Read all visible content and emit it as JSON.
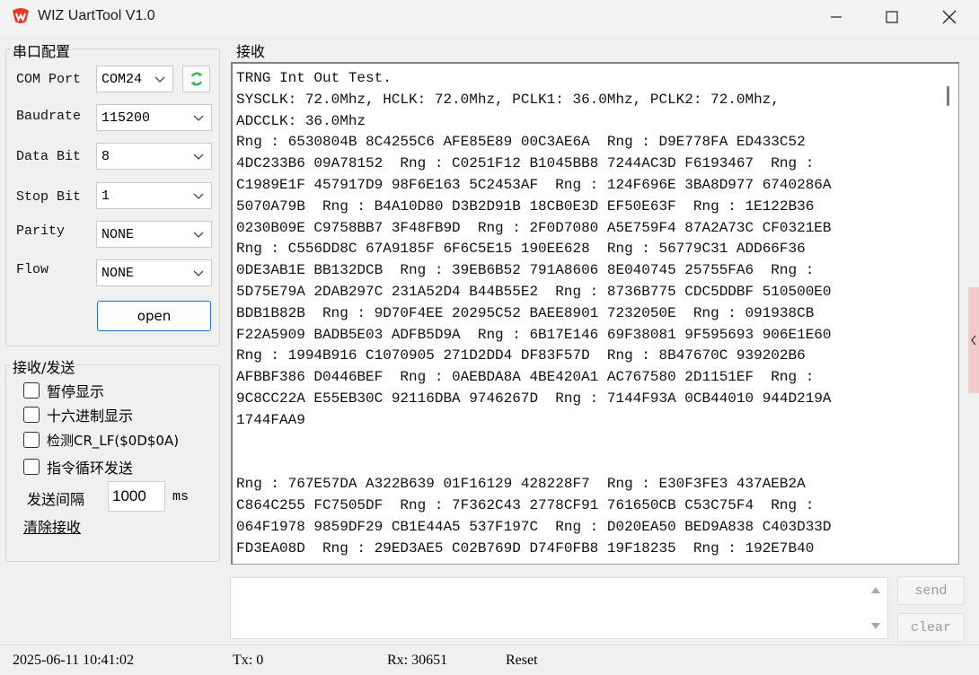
{
  "window": {
    "title": "WIZ UartTool V1.0"
  },
  "serial": {
    "group_title": "串口配置",
    "com_port": {
      "label": "COM Port",
      "value": "COM24"
    },
    "baudrate": {
      "label": "Baudrate",
      "value": "115200"
    },
    "data_bit": {
      "label": "Data Bit",
      "value": "8"
    },
    "stop_bit": {
      "label": "Stop Bit",
      "value": "1"
    },
    "parity": {
      "label": "Parity",
      "value": "NONE"
    },
    "flow": {
      "label": "Flow",
      "value": "NONE"
    },
    "open_label": "open",
    "refresh_icon": "refresh-icon",
    "refresh_color": "#2fb84a"
  },
  "rxtx": {
    "group_title": "接收/发送",
    "pause_display": "暂停显示",
    "hex_display": "十六进制显示",
    "detect_crlf": "检测CR_LF($0D$0A)",
    "loop_send": "指令循环发送",
    "interval_label": "发送间隔",
    "interval_value": "1000",
    "interval_unit": "ms",
    "clear_label": "清除接收"
  },
  "receive": {
    "title": "接收",
    "lines": [
      "TRNG Int Out Test.",
      "SYSCLK: 72.0Mhz, HCLK: 72.0Mhz, PCLK1: 36.0Mhz, PCLK2: 72.0Mhz,",
      "ADCCLK: 36.0Mhz",
      "Rng : 6530804B 8C4255C6 AFE85E89 00C3AE6A  Rng : D9E778FA ED433C52",
      "4DC233B6 09A78152  Rng : C0251F12 B1045BB8 7244AC3D F6193467  Rng :",
      "C1989E1F 457917D9 98F6E163 5C2453AF  Rng : 124F696E 3BA8D977 6740286A",
      "5070A79B  Rng : B4A10D80 D3B2D91B 18CB0E3D EF50E63F  Rng : 1E122B36",
      "0230B09E C9758BB7 3F48FB9D  Rng : 2F0D7080 A5E759F4 87A2A73C CF0321EB",
      "Rng : C556DD8C 67A9185F 6F6C5E15 190EE628  Rng : 56779C31 ADD66F36",
      "0DE3AB1E BB132DCB  Rng : 39EB6B52 791A8606 8E040745 25755FA6  Rng :",
      "5D75E79A 2DAB297C 231A52D4 B44B55E2  Rng : 8736B775 CDC5DDBF 510500E0",
      "BDB1B82B  Rng : 9D70F4EE 20295C52 BAEE8901 7232050E  Rng : 091938CB",
      "F22A5909 BADB5E03 ADFB5D9A  Rng : 6B17E146 69F38081 9F595693 906E1E60",
      "Rng : 1994B916 C1070905 271D2DD4 DF83F57D  Rng : 8B47670C 939202B6",
      "AFBBF386 D0446BEF  Rng : 0AEBDA8A 4BE420A1 AC767580 2D1151EF  Rng :",
      "9C8CC22A E55EB30C 92116DBA 9746267D  Rng : 7144F93A 0CB44010 944D219A",
      "1744FAA9",
      "",
      "",
      "Rng : 767E57DA A322B639 01F16129 428228F7  Rng : E30F3FE3 437AEB2A",
      "C864C255 FC7505DF  Rng : 7F362C43 2778CF91 761650CB C53C75F4  Rng :",
      "064F1978 9859DF29 CB1E44A5 537F197C  Rng : D020EA50 BED9A838 C403D33D",
      "FD3EA08D  Rng : 29ED3AE5 C02B769D D74F0FB8 19F18235  Rng : 192E7B40"
    ]
  },
  "send": {
    "send_label": "send",
    "clear_label": "clear"
  },
  "status": {
    "datetime": "2025-06-11 10:41:02",
    "tx": "Tx: 0",
    "rx": "Rx: 30651",
    "reset": "Reset"
  }
}
